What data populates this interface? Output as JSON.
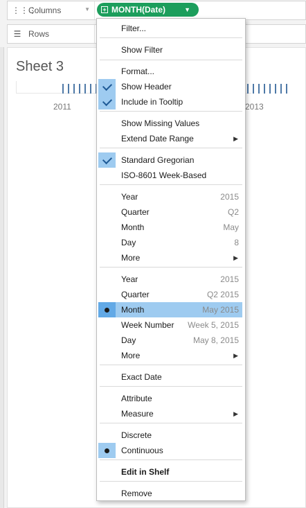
{
  "shelves": {
    "columns_label": "Columns",
    "rows_label": "Rows",
    "columns_pill": "MONTH(Date)"
  },
  "sheet": {
    "title": "Sheet 3",
    "axis_labels": [
      "2011",
      "2013"
    ]
  },
  "colors": {
    "pill": "#1c9e5c",
    "highlight": "#9ecbf0",
    "marks": "#4e79a7"
  },
  "menu": {
    "filter": "Filter...",
    "show_filter": "Show Filter",
    "format": "Format...",
    "show_header": "Show Header",
    "include_tooltip": "Include in Tooltip",
    "show_missing": "Show Missing Values",
    "extend_date": "Extend Date Range",
    "standard_gregorian": "Standard Gregorian",
    "iso_week": "ISO-8601 Week-Based",
    "discrete_parts": [
      {
        "label": "Year",
        "hint": "2015"
      },
      {
        "label": "Quarter",
        "hint": "Q2"
      },
      {
        "label": "Month",
        "hint": "May"
      },
      {
        "label": "Day",
        "hint": "8"
      },
      {
        "label": "More",
        "hint": ""
      }
    ],
    "continuous_parts": [
      {
        "label": "Year",
        "hint": "2015"
      },
      {
        "label": "Quarter",
        "hint": "Q2 2015"
      },
      {
        "label": "Month",
        "hint": "May 2015"
      },
      {
        "label": "Week Number",
        "hint": "Week 5, 2015"
      },
      {
        "label": "Day",
        "hint": "May 8, 2015"
      },
      {
        "label": "More",
        "hint": ""
      }
    ],
    "exact_date": "Exact Date",
    "attribute": "Attribute",
    "measure": "Measure",
    "discrete": "Discrete",
    "continuous": "Continuous",
    "edit_in_shelf": "Edit in Shelf",
    "remove": "Remove"
  }
}
